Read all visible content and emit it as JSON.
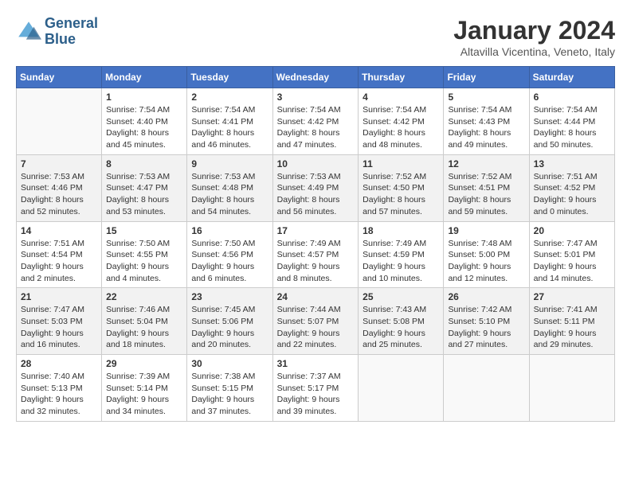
{
  "header": {
    "logo_line1": "General",
    "logo_line2": "Blue",
    "month_title": "January 2024",
    "location": "Altavilla Vicentina, Veneto, Italy"
  },
  "days_of_week": [
    "Sunday",
    "Monday",
    "Tuesday",
    "Wednesday",
    "Thursday",
    "Friday",
    "Saturday"
  ],
  "weeks": [
    [
      {
        "day": "",
        "info": ""
      },
      {
        "day": "1",
        "info": "Sunrise: 7:54 AM\nSunset: 4:40 PM\nDaylight: 8 hours\nand 45 minutes."
      },
      {
        "day": "2",
        "info": "Sunrise: 7:54 AM\nSunset: 4:41 PM\nDaylight: 8 hours\nand 46 minutes."
      },
      {
        "day": "3",
        "info": "Sunrise: 7:54 AM\nSunset: 4:42 PM\nDaylight: 8 hours\nand 47 minutes."
      },
      {
        "day": "4",
        "info": "Sunrise: 7:54 AM\nSunset: 4:42 PM\nDaylight: 8 hours\nand 48 minutes."
      },
      {
        "day": "5",
        "info": "Sunrise: 7:54 AM\nSunset: 4:43 PM\nDaylight: 8 hours\nand 49 minutes."
      },
      {
        "day": "6",
        "info": "Sunrise: 7:54 AM\nSunset: 4:44 PM\nDaylight: 8 hours\nand 50 minutes."
      }
    ],
    [
      {
        "day": "7",
        "info": "Sunrise: 7:53 AM\nSunset: 4:46 PM\nDaylight: 8 hours\nand 52 minutes."
      },
      {
        "day": "8",
        "info": "Sunrise: 7:53 AM\nSunset: 4:47 PM\nDaylight: 8 hours\nand 53 minutes."
      },
      {
        "day": "9",
        "info": "Sunrise: 7:53 AM\nSunset: 4:48 PM\nDaylight: 8 hours\nand 54 minutes."
      },
      {
        "day": "10",
        "info": "Sunrise: 7:53 AM\nSunset: 4:49 PM\nDaylight: 8 hours\nand 56 minutes."
      },
      {
        "day": "11",
        "info": "Sunrise: 7:52 AM\nSunset: 4:50 PM\nDaylight: 8 hours\nand 57 minutes."
      },
      {
        "day": "12",
        "info": "Sunrise: 7:52 AM\nSunset: 4:51 PM\nDaylight: 8 hours\nand 59 minutes."
      },
      {
        "day": "13",
        "info": "Sunrise: 7:51 AM\nSunset: 4:52 PM\nDaylight: 9 hours\nand 0 minutes."
      }
    ],
    [
      {
        "day": "14",
        "info": "Sunrise: 7:51 AM\nSunset: 4:54 PM\nDaylight: 9 hours\nand 2 minutes."
      },
      {
        "day": "15",
        "info": "Sunrise: 7:50 AM\nSunset: 4:55 PM\nDaylight: 9 hours\nand 4 minutes."
      },
      {
        "day": "16",
        "info": "Sunrise: 7:50 AM\nSunset: 4:56 PM\nDaylight: 9 hours\nand 6 minutes."
      },
      {
        "day": "17",
        "info": "Sunrise: 7:49 AM\nSunset: 4:57 PM\nDaylight: 9 hours\nand 8 minutes."
      },
      {
        "day": "18",
        "info": "Sunrise: 7:49 AM\nSunset: 4:59 PM\nDaylight: 9 hours\nand 10 minutes."
      },
      {
        "day": "19",
        "info": "Sunrise: 7:48 AM\nSunset: 5:00 PM\nDaylight: 9 hours\nand 12 minutes."
      },
      {
        "day": "20",
        "info": "Sunrise: 7:47 AM\nSunset: 5:01 PM\nDaylight: 9 hours\nand 14 minutes."
      }
    ],
    [
      {
        "day": "21",
        "info": "Sunrise: 7:47 AM\nSunset: 5:03 PM\nDaylight: 9 hours\nand 16 minutes."
      },
      {
        "day": "22",
        "info": "Sunrise: 7:46 AM\nSunset: 5:04 PM\nDaylight: 9 hours\nand 18 minutes."
      },
      {
        "day": "23",
        "info": "Sunrise: 7:45 AM\nSunset: 5:06 PM\nDaylight: 9 hours\nand 20 minutes."
      },
      {
        "day": "24",
        "info": "Sunrise: 7:44 AM\nSunset: 5:07 PM\nDaylight: 9 hours\nand 22 minutes."
      },
      {
        "day": "25",
        "info": "Sunrise: 7:43 AM\nSunset: 5:08 PM\nDaylight: 9 hours\nand 25 minutes."
      },
      {
        "day": "26",
        "info": "Sunrise: 7:42 AM\nSunset: 5:10 PM\nDaylight: 9 hours\nand 27 minutes."
      },
      {
        "day": "27",
        "info": "Sunrise: 7:41 AM\nSunset: 5:11 PM\nDaylight: 9 hours\nand 29 minutes."
      }
    ],
    [
      {
        "day": "28",
        "info": "Sunrise: 7:40 AM\nSunset: 5:13 PM\nDaylight: 9 hours\nand 32 minutes."
      },
      {
        "day": "29",
        "info": "Sunrise: 7:39 AM\nSunset: 5:14 PM\nDaylight: 9 hours\nand 34 minutes."
      },
      {
        "day": "30",
        "info": "Sunrise: 7:38 AM\nSunset: 5:15 PM\nDaylight: 9 hours\nand 37 minutes."
      },
      {
        "day": "31",
        "info": "Sunrise: 7:37 AM\nSunset: 5:17 PM\nDaylight: 9 hours\nand 39 minutes."
      },
      {
        "day": "",
        "info": ""
      },
      {
        "day": "",
        "info": ""
      },
      {
        "day": "",
        "info": ""
      }
    ]
  ]
}
